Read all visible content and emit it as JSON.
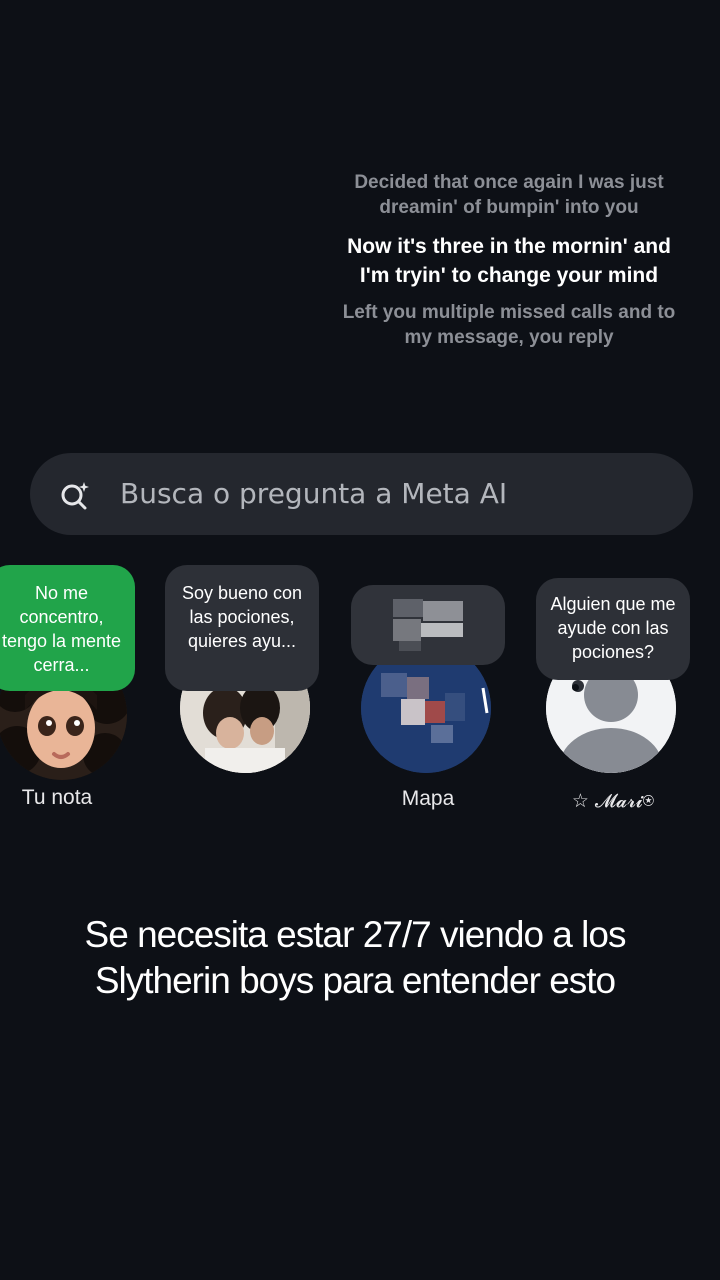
{
  "lyrics": {
    "previous": "Decided that once again I was just dreamin' of bumpin' into you",
    "current": "Now it's three in the mornin' and I'm tryin' to change your mind",
    "next": "Left you multiple missed calls and to my message, you reply"
  },
  "search": {
    "icon": "meta-ai-search-icon",
    "placeholder": "Busca o pregunta a Meta AI"
  },
  "notes": [
    {
      "bubble": "No me concentro, tengo la mente cerra...",
      "name": "Tu nota",
      "bubble_color": "#21a44a"
    },
    {
      "bubble": "Soy bueno con las pociones, quieres ayu...",
      "name": ""
    },
    {
      "bubble": "",
      "name": "Mapa"
    },
    {
      "bubble": "Alguien que me ayude con las pociones?",
      "name": "☆ 𝓜𝓪𝓻𝓲⍟"
    }
  ],
  "caption": "Se necesita estar 27/7 viendo a los Slytherin boys para entender esto",
  "colors": {
    "background": "#0d1016",
    "note_green": "#21a44a",
    "search_bg": "#24272e"
  }
}
